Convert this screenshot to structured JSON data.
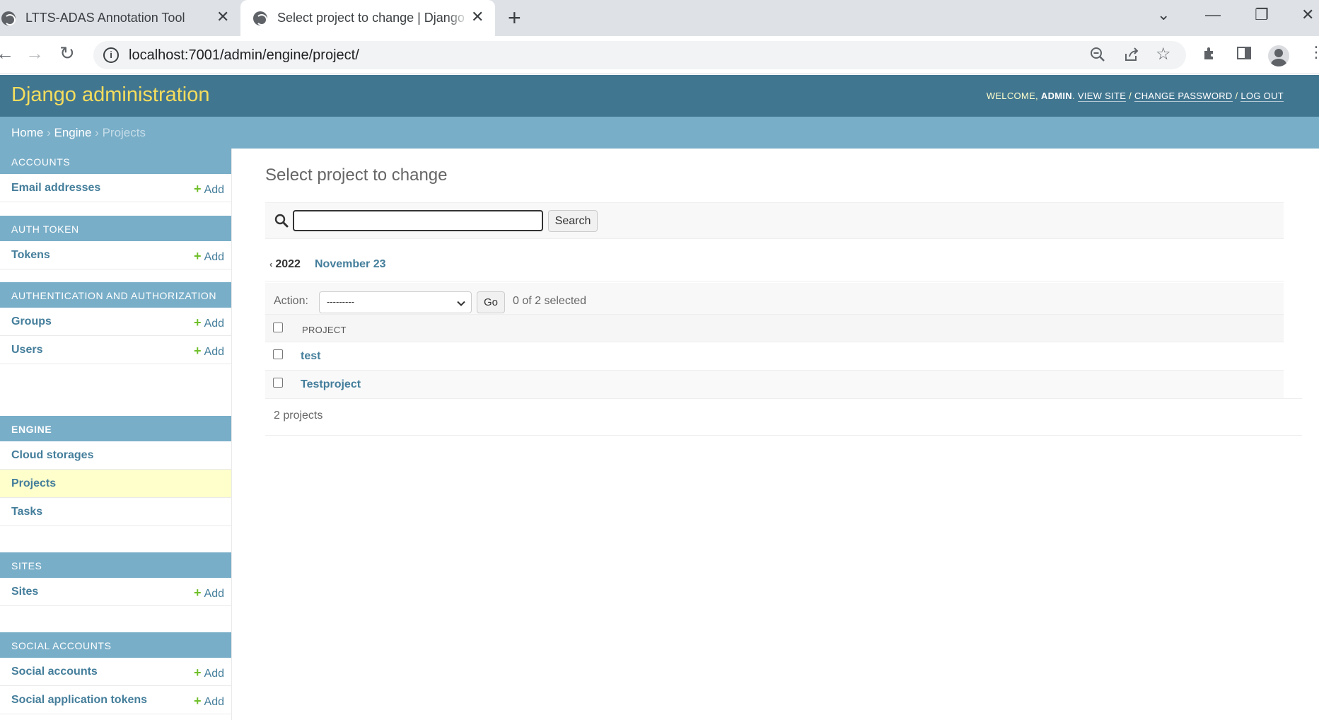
{
  "browser": {
    "tabs": [
      {
        "title": "LTTS-ADAS Annotation Tool",
        "active": false
      },
      {
        "title": "Select project to change | Django site admin",
        "active": true
      }
    ],
    "url": "localhost:7001/admin/engine/project/"
  },
  "header": {
    "branding": "Django administration",
    "welcome": "Welcome,",
    "username": "admin",
    "view_site": "View site",
    "change_password": "Change password",
    "log_out": "Log out",
    "separator": "/"
  },
  "breadcrumbs": {
    "home": "Home",
    "app": "Engine",
    "current": "Projects",
    "sep": "›"
  },
  "sidebar": {
    "add_label": "Add",
    "modules": [
      {
        "caption": "Accounts",
        "models": [
          {
            "name": "Email addresses",
            "add": true
          }
        ]
      },
      {
        "caption": "Auth Token",
        "models": [
          {
            "name": "Tokens",
            "add": true
          }
        ]
      },
      {
        "caption": "Authentication and Authorization",
        "models": [
          {
            "name": "Groups",
            "add": true
          },
          {
            "name": "Users",
            "add": true
          }
        ]
      },
      {
        "caption": "Engine",
        "models": [
          {
            "name": "Cloud storages",
            "add": false
          },
          {
            "name": "Projects",
            "add": false,
            "current": true
          },
          {
            "name": "Tasks",
            "add": false
          }
        ]
      },
      {
        "caption": "Sites",
        "models": [
          {
            "name": "Sites",
            "add": true
          }
        ]
      },
      {
        "caption": "Social Accounts",
        "models": [
          {
            "name": "Social accounts",
            "add": true
          },
          {
            "name": "Social application tokens",
            "add": true
          }
        ]
      }
    ]
  },
  "main": {
    "title": "Select project to change",
    "search": {
      "value": "",
      "placeholder": "",
      "button": "Search"
    },
    "date_hierarchy": {
      "back": "‹",
      "year": "2022",
      "current": "November 23"
    },
    "actions": {
      "label": "Action:",
      "selected": "---------",
      "go": "Go",
      "counter": "0 of 2 selected"
    },
    "table": {
      "header": "Project",
      "rows": [
        "test",
        "Testproject"
      ]
    },
    "paginator": "2 projects"
  },
  "colors": {
    "header_bg": "#417690",
    "branding": "#f5dd5d",
    "module_caption_bg": "#79aec8",
    "link": "#447e9b",
    "add_plus": "#70bf2b",
    "current_row": "#ffffcc"
  }
}
